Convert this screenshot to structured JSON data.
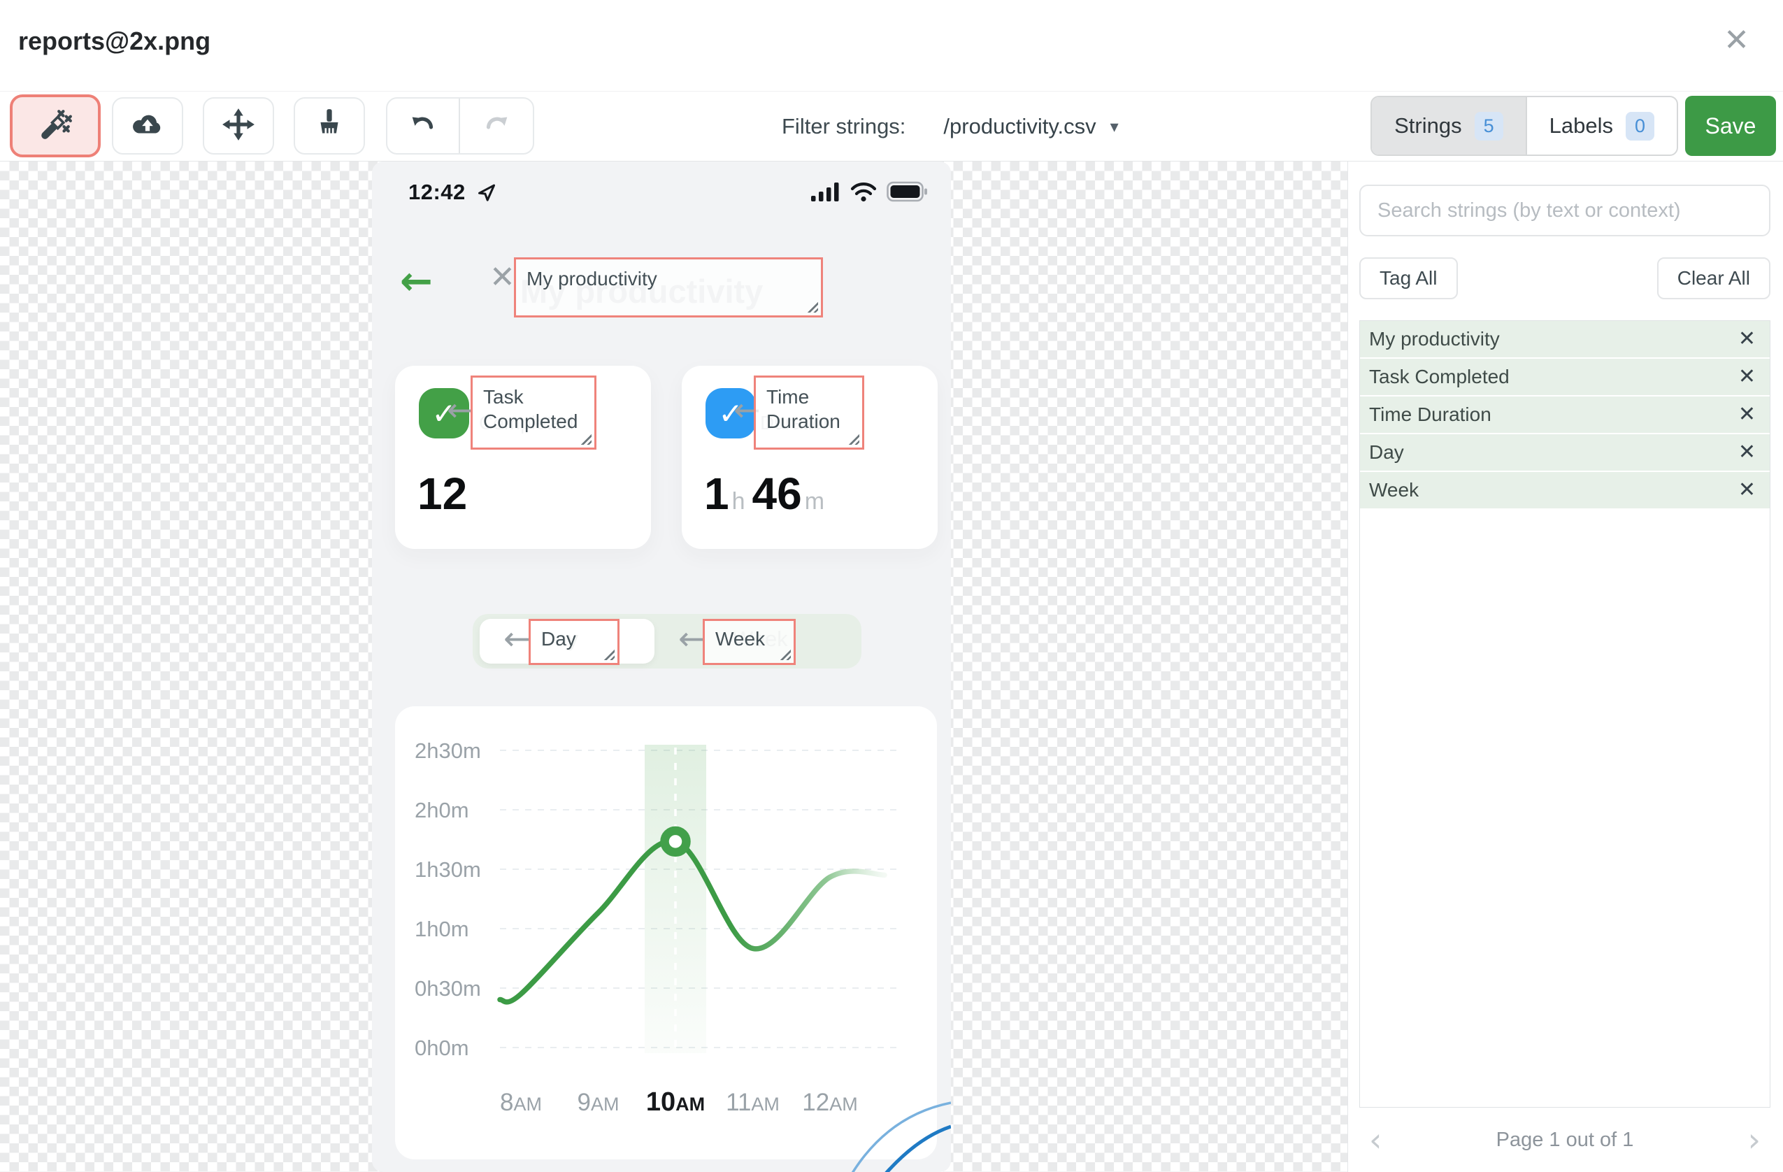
{
  "header": {
    "title": "reports@2x.png"
  },
  "toolbar": {
    "filter_label": "Filter strings:",
    "filter_value": "/productivity.csv",
    "strings_tab": "Strings",
    "strings_count": "5",
    "labels_tab": "Labels",
    "labels_count": "0",
    "save": "Save"
  },
  "phone": {
    "status_time": "12:42",
    "title_ghost": "My productivity",
    "title_tag": "My productivity",
    "cards": [
      {
        "tag_line1": "Task",
        "tag_line2": "Completed",
        "ghost": "Completed",
        "value": "12"
      },
      {
        "tag_line1": "Time",
        "tag_line2": "Duration",
        "ghost": "Duration",
        "value_num1": "1",
        "value_unit1": "h",
        "value_num2": "46",
        "value_unit2": "m"
      }
    ],
    "toggle": {
      "day_tag": "Day",
      "day_ghost": "Day",
      "week_tag": "Week",
      "week_ghost": "Week"
    }
  },
  "chart_data": {
    "type": "line",
    "categories": [
      "8AM",
      "9AM",
      "10AM",
      "11AM",
      "12AM"
    ],
    "values_minutes": [
      27,
      68,
      104,
      50,
      86
    ],
    "series": [
      {
        "name": "time-duration",
        "values": [
          27,
          68,
          104,
          50,
          86
        ]
      }
    ],
    "ytick_labels": [
      "2h30m",
      "2h0m",
      "1h30m",
      "1h0m",
      "0h30m",
      "0h0m"
    ],
    "ylim_minutes": [
      0,
      150
    ],
    "grid": "dashed-horizontal",
    "legend": "none",
    "highlight_category": "10AM",
    "marker": {
      "category": "10AM",
      "value_minutes": 104
    },
    "line_color": "#3c9b45",
    "fade_right": true
  },
  "sidebar": {
    "search_placeholder": "Search strings (by text or context)",
    "tag_all": "Tag All",
    "clear_all": "Clear All",
    "strings": [
      "My productivity",
      "Task Completed",
      "Time Duration",
      "Day",
      "Week"
    ],
    "pagination": "Page 1 out of 1"
  },
  "icons": {
    "close": "✕",
    "caret_down": "▾",
    "back_arrow": "←",
    "tag_arrow": "←",
    "check": "✓",
    "chev_left": "‹",
    "chev_right": "›",
    "x": "✕"
  },
  "colors": {
    "accent_green": "#3d9a46",
    "tag_red": "#ef837b",
    "badge_blue": "#478fd6",
    "task_icon_green": "#43a047",
    "time_icon_blue": "#2d9cf4",
    "list_item_green": "#e7f0e8"
  }
}
